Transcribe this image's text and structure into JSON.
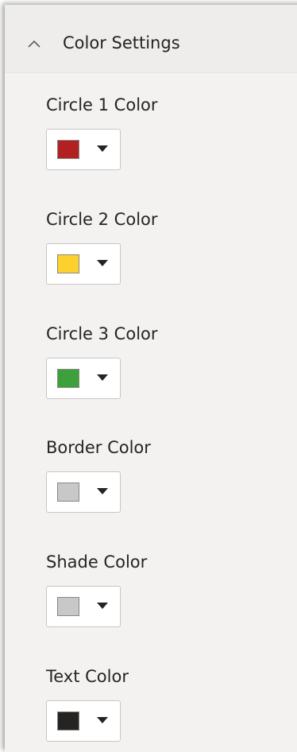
{
  "section": {
    "title": "Color Settings",
    "expanded": true
  },
  "settings": [
    {
      "label": "Circle 1 Color",
      "color": "#b0211f"
    },
    {
      "label": "Circle 2 Color",
      "color": "#fcd02d"
    },
    {
      "label": "Circle 3 Color",
      "color": "#3da13b"
    },
    {
      "label": "Border Color",
      "color": "#c8c8c8"
    },
    {
      "label": "Shade Color",
      "color": "#c8c8c8"
    },
    {
      "label": "Text Color",
      "color": "#252423"
    }
  ],
  "icons": {
    "header": "chevron-up-icon",
    "picker": "caret-down-icon"
  }
}
